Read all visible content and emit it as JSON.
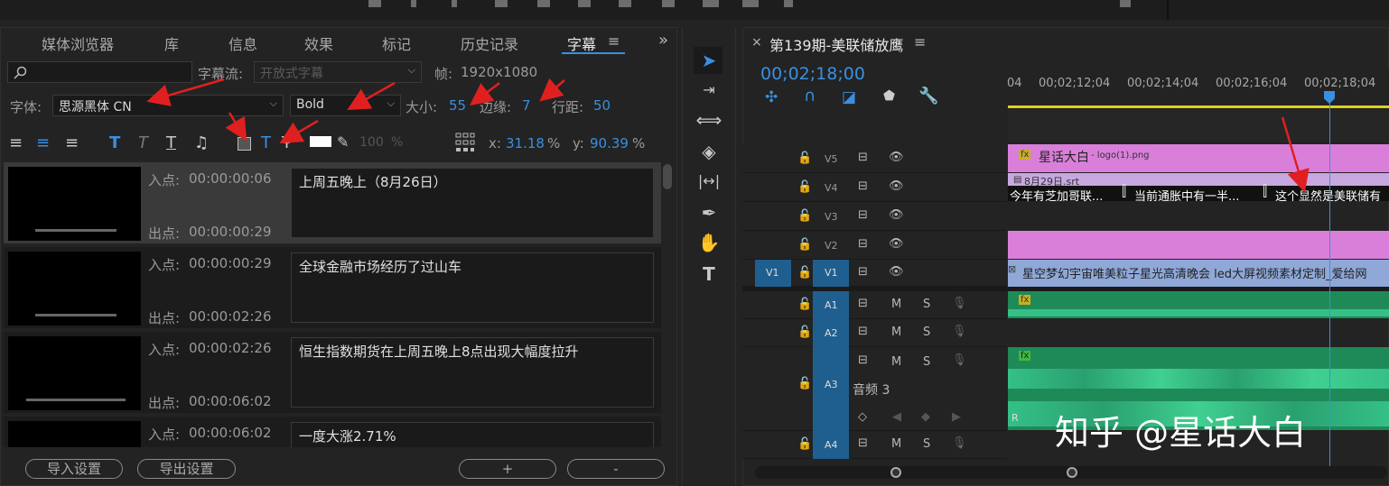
{
  "left_tabs": [
    "媒体浏览器",
    "库",
    "信息",
    "效果",
    "标记",
    "历史记录",
    "字幕"
  ],
  "left_tabs_more": "»",
  "menu_icon": "≡",
  "caption_stream_label": "字幕流:",
  "caption_stream_value": "开放式字幕",
  "frame_label": "帧:",
  "frame_value": "1920x1080",
  "font_label": "字体:",
  "font_value": "思源黑体 CN",
  "style_value": "Bold",
  "size_label": "大小:",
  "size_value": "55",
  "edge_label": "边缘:",
  "edge_value": "7",
  "leading_label": "行距:",
  "leading_value": "50",
  "opacity_value": "100",
  "pct": "%",
  "x_label": "x:",
  "x_value": "31.18",
  "y_label": "y:",
  "y_value": "90.39",
  "in_label": "入点:",
  "out_label": "出点:",
  "captions": [
    {
      "in": "00:00:00:06",
      "out": "00:00:00:29",
      "text": "上周五晚上（8月26日）"
    },
    {
      "in": "00:00:00:29",
      "out": "00:00:02:26",
      "text": "全球金融市场经历了过山车"
    },
    {
      "in": "00:00:02:26",
      "out": "00:00:06:02",
      "text": "恒生指数期货在上周五晚上8点出现大幅度拉升"
    },
    {
      "in": "00:00:06:02",
      "out": "",
      "text": "一度大涨2.71%"
    }
  ],
  "import_btn": "导入设置",
  "export_btn": "导出设置",
  "add_btn": "+",
  "remove_btn": "-",
  "seq_title": "第139期-美联储放鹰",
  "timecode": "00;02;18;00",
  "ruler": [
    "04",
    "00;02;12;04",
    "00;02;14;04",
    "00;02;16;04",
    "00;02;18;04"
  ],
  "video_tracks": [
    "V5",
    "V4",
    "V3",
    "V2",
    "V1"
  ],
  "source_v1": "V1",
  "audio_tracks": [
    "A1",
    "A2",
    "A3",
    "A4"
  ],
  "audio_name": "音频 3",
  "mute": "M",
  "solo": "S",
  "clip_v5": "星话大白",
  "clip_v5_file": " - logo(1).png",
  "clip_v4_file": "8月29日.srt",
  "clip_v4_caps": [
    "今年有芝加哥联...",
    "当前通胀中有一半...",
    "这个显然是美联储有"
  ],
  "clip_v1": "星空梦幻宇宙唯美粒子星光高清晚会 led大屏视频素材定制_爱给网",
  "watermark": "知乎 @星话大白",
  "colors": {
    "accent": "#3a8fe0",
    "pink": "#d97fd9",
    "v1clip": "#8fa8d8",
    "audio": "#2fa36f",
    "track_blue": "#1f5f8f"
  }
}
